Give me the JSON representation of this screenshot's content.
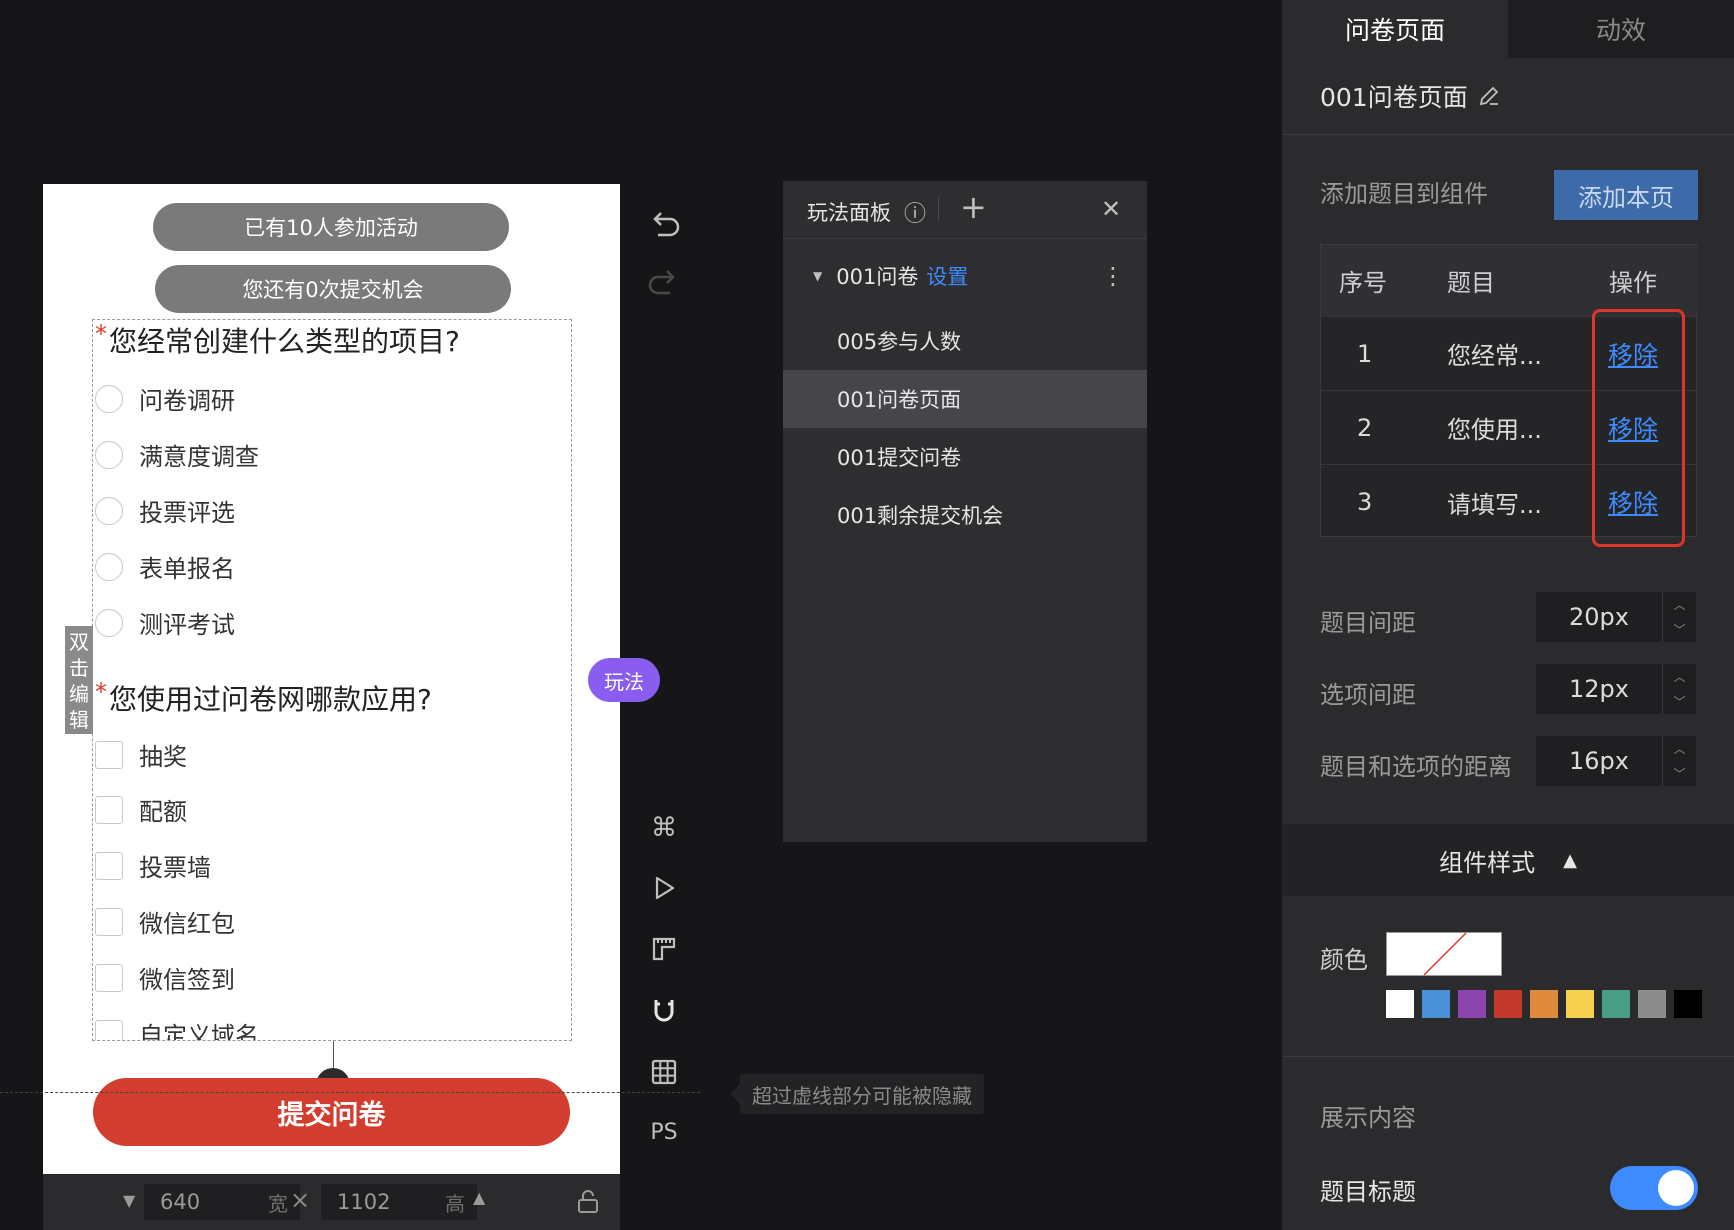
{
  "canvas": {
    "participants_pill": "已有10人参加活动",
    "chances_pill": "您还有0次提交机会",
    "q1": {
      "title": "您经常创建什么类型的项目?",
      "required_mark": "*",
      "options": [
        "问卷调研",
        "满意度调查",
        "投票评选",
        "表单报名",
        "测评考试"
      ]
    },
    "q2": {
      "title": "您使用过问卷网哪款应用?",
      "required_mark": "*",
      "options": [
        "抽奖",
        "配额",
        "投票墙",
        "微信红包",
        "微信签到",
        "自定义域名"
      ]
    },
    "submit_label": "提交问卷",
    "dblclick_label": "双击编辑",
    "play_badge": "玩法"
  },
  "dimensions": {
    "width": "640",
    "width_unit": "宽",
    "height": "1102",
    "height_unit": "高",
    "times": "×"
  },
  "toolbar": {
    "ps_label": "PS",
    "tooltip": "超过虚线部分可能被隐藏"
  },
  "play_panel": {
    "title": "玩法面板",
    "info_icon": "ⓘ",
    "add_icon": "+",
    "close_icon": "✕",
    "group": {
      "name": "001问卷",
      "settings_link": "设置",
      "more_icon": "⋮"
    },
    "items": [
      "005参与人数",
      "001问卷页面",
      "001提交问卷",
      "001剩余提交机会"
    ],
    "selected_index": 1
  },
  "settings": {
    "tabs": [
      "问卷页面",
      "动效"
    ],
    "active_tab": 0,
    "page_name": "001问卷页面",
    "add_question_label": "添加题目到组件",
    "add_page_button": "添加本页",
    "table": {
      "headers": [
        "序号",
        "题目",
        "操作"
      ],
      "rows": [
        {
          "index": "1",
          "title": "您经常...",
          "action": "移除"
        },
        {
          "index": "2",
          "title": "您使用...",
          "action": "移除"
        },
        {
          "index": "3",
          "title": "请填写...",
          "action": "移除"
        }
      ]
    },
    "spacing": [
      {
        "label": "题目间距",
        "value": "20px"
      },
      {
        "label": "选项间距",
        "value": "12px"
      },
      {
        "label": "题目和选项的距离",
        "value": "16px"
      }
    ],
    "style_section": "组件样式",
    "color_label": "颜色",
    "palette": [
      "#ffffff",
      "#4a90d9",
      "#8e44ad",
      "#c0392b",
      "#e08a3c",
      "#f5d14f",
      "#4a9e86",
      "#8c8c8c",
      "#000000"
    ],
    "display_section": "展示内容",
    "question_title_label": "题目标题",
    "question_title_on": true
  },
  "colors": {
    "accent": "#3e8bff",
    "danger": "#d33d2f",
    "highlight": "#e0352b",
    "toggle": "#3e8bff"
  }
}
